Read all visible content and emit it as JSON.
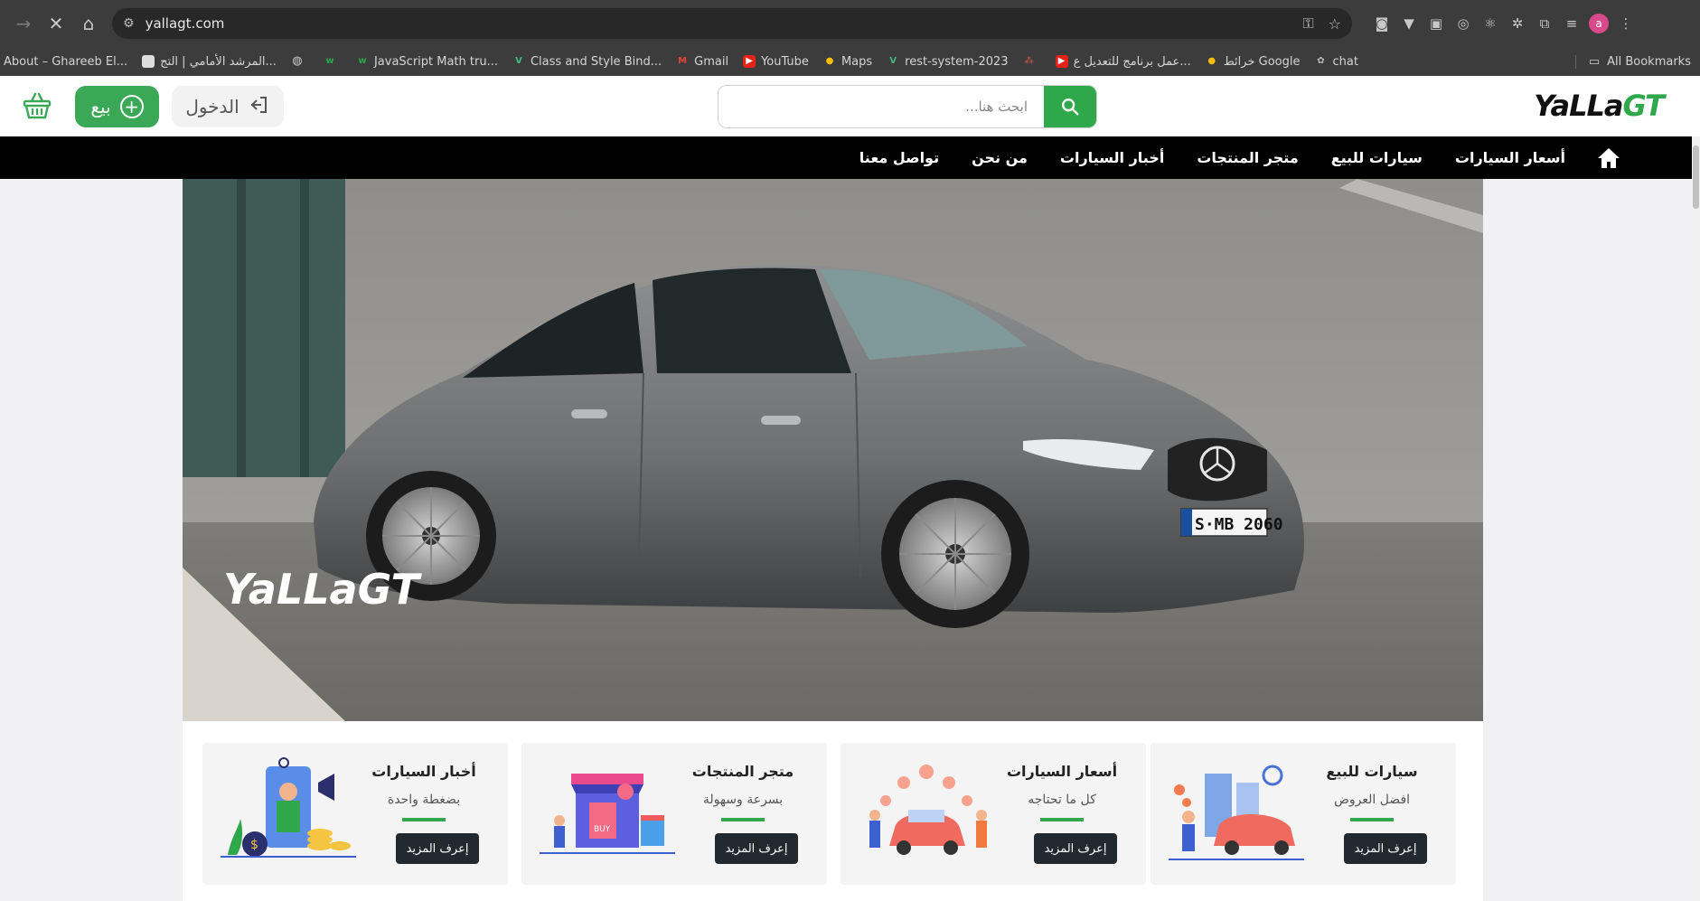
{
  "browser": {
    "url": "yallagt.com",
    "bookmarks": [
      "About – Ghareeb El...",
      "المرشد الأمامي | التج...",
      "",
      "",
      "JavaScript Math tru...",
      "Class and Style Bind...",
      "Gmail",
      "YouTube",
      "Maps",
      "rest-system-2023",
      "",
      "عمل برنامج للتعديل ع...",
      "خرائط Google",
      "chat"
    ],
    "all_bookmarks": "All Bookmarks",
    "profile_initial": "a"
  },
  "header": {
    "logo_text": "YaLLa",
    "logo_accent": "GT",
    "search_placeholder": "ابحث هنا...",
    "login_label": "الدخول",
    "sell_label": "بيع"
  },
  "nav": {
    "items": [
      "أسعار السيارات",
      "سيارات للبيع",
      "متجر المنتجات",
      "أخبار السيارات",
      "من نحن",
      "تواصل معنا"
    ]
  },
  "hero": {
    "watermark_text": "YaLLa",
    "watermark_accent": "GT",
    "plate_text": "S·MB 2060"
  },
  "cards": [
    {
      "title": "سيارات للبيع",
      "subtitle": "افضل العروض",
      "button": "إعرف المزيد"
    },
    {
      "title": "أسعار السيارات",
      "subtitle": "كل ما تحتاجه",
      "button": "إعرف المزيد"
    },
    {
      "title": "متجر المنتجات",
      "subtitle": "بسرعة وسهولة",
      "button": "إعرف المزيد"
    },
    {
      "title": "أخبار السيارات",
      "subtitle": "بضغطة واحدة",
      "button": "إعرف المزيد"
    }
  ],
  "colors": {
    "brand_green": "#2ea84a",
    "nav_black": "#000000",
    "button_dark": "#222a30"
  }
}
